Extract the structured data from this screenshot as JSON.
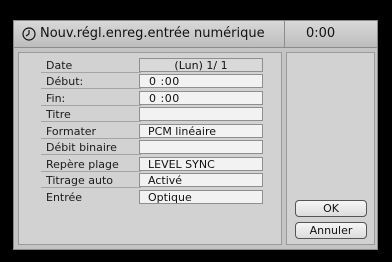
{
  "header": {
    "title": "Nouv.régl.enreg.entrée numérique",
    "time": "0:00",
    "icon": "clock-icon"
  },
  "fields": [
    {
      "label": "Date",
      "value": "(Lun) 1/ 1"
    },
    {
      "label": "Début:",
      "value": "0 :00"
    },
    {
      "label": "Fin:",
      "value": "0 :00"
    },
    {
      "label": "Titre",
      "value": ""
    },
    {
      "label": "Formater",
      "value": "PCM linéaire"
    },
    {
      "label": "Débit binaire",
      "value": ""
    },
    {
      "label": "Repère plage",
      "value": "LEVEL SYNC"
    },
    {
      "label": "Titrage auto",
      "value": "Activé"
    },
    {
      "label": "Entrée",
      "value": "Optique"
    }
  ],
  "buttons": {
    "ok": "OK",
    "cancel": "Annuler"
  }
}
